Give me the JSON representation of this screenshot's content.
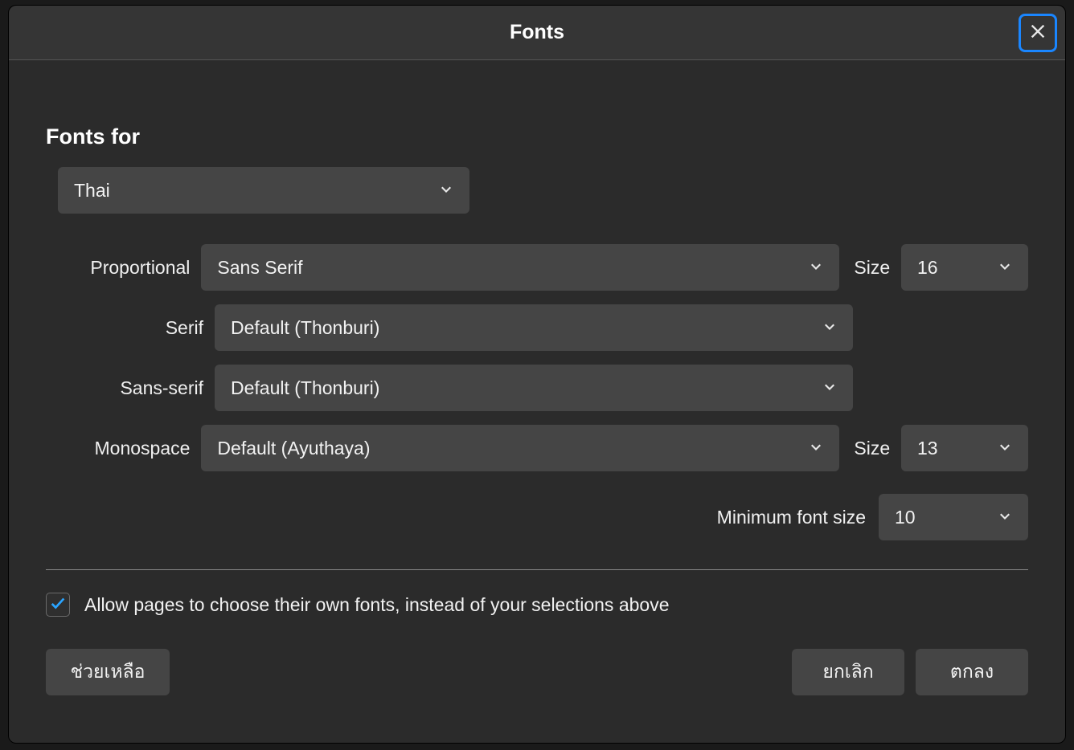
{
  "dialog": {
    "title": "Fonts"
  },
  "section": {
    "title": "Fonts for"
  },
  "language": {
    "selected": "Thai"
  },
  "labels": {
    "proportional": "Proportional",
    "serif": "Serif",
    "sansSerif": "Sans-serif",
    "monospace": "Monospace",
    "size": "Size",
    "minimumFontSize": "Minimum font size"
  },
  "fonts": {
    "proportional": {
      "value": "Sans Serif",
      "size": "16"
    },
    "serif": {
      "value": "Default (Thonburi)"
    },
    "sansSerif": {
      "value": "Default (Thonburi)"
    },
    "monospace": {
      "value": "Default (Ayuthaya)",
      "size": "13"
    }
  },
  "minimumSize": {
    "value": "10"
  },
  "allowPages": {
    "checked": true,
    "label": "Allow pages to choose their own fonts, instead of your selections above"
  },
  "buttons": {
    "help": "ช่วยเหลือ",
    "cancel": "ยกเลิก",
    "ok": "ตกลง"
  }
}
